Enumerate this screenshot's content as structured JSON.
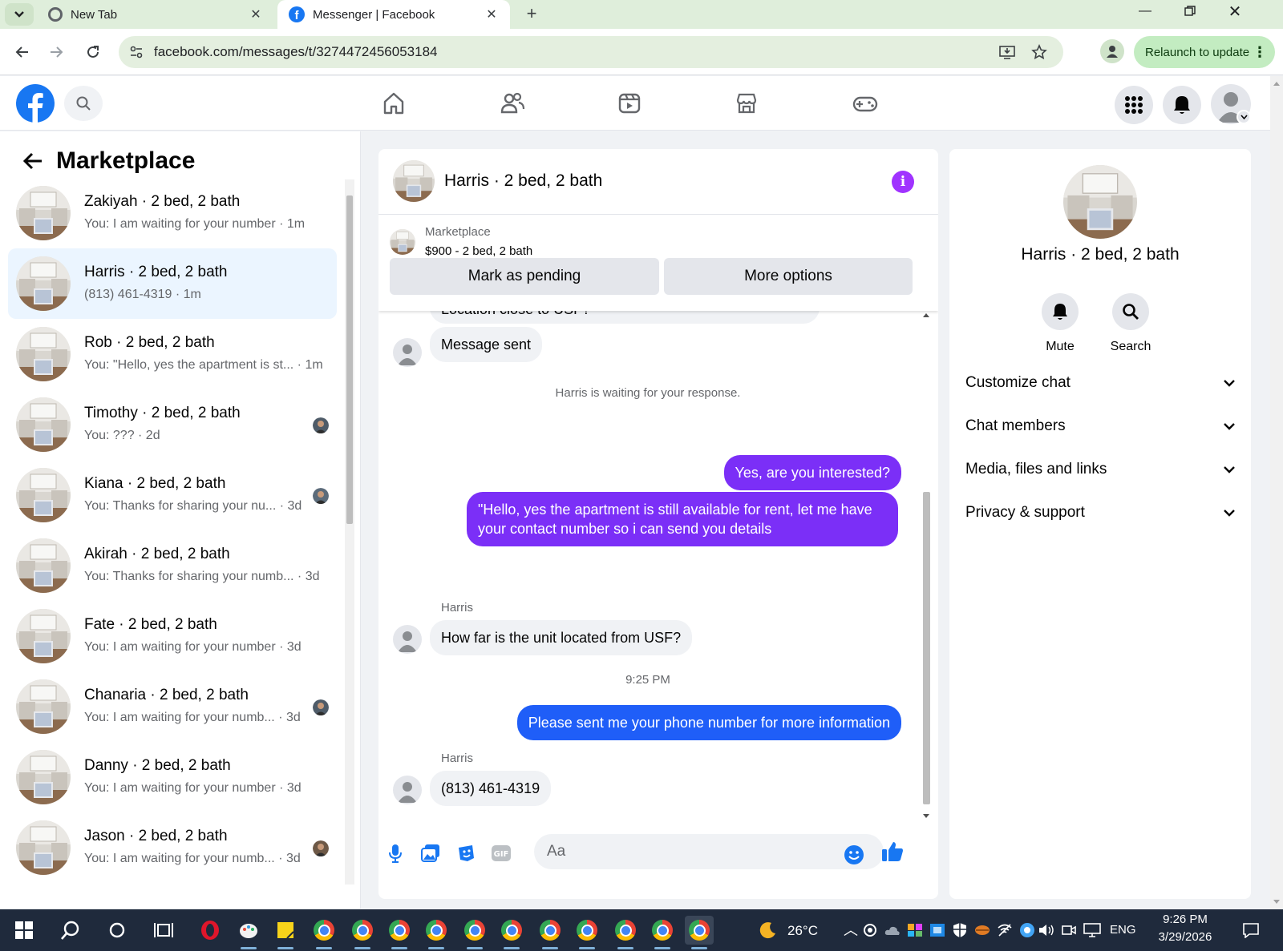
{
  "browser": {
    "tabs": [
      {
        "title": "New Tab"
      },
      {
        "title": "Messenger | Facebook"
      }
    ],
    "url": "facebook.com/messages/t/3274472456053184",
    "relaunch_label": "Relaunch to update"
  },
  "left": {
    "title": "Marketplace",
    "conversations": [
      {
        "name": "Zakiyah · 2 bed, 2 bath",
        "preview": "You: I am waiting for your number · 1m",
        "seen": false,
        "selected": false
      },
      {
        "name": "Harris · 2 bed, 2 bath",
        "preview": "(813) 461-4319 · 1m",
        "seen": false,
        "selected": true
      },
      {
        "name": "Rob · 2 bed, 2 bath",
        "preview": "You: \"Hello, yes the apartment is st... · 1m",
        "seen": false,
        "selected": false
      },
      {
        "name": "Timothy · 2 bed, 2 bath",
        "preview": "You: ??? · 2d",
        "seen": true,
        "selected": false
      },
      {
        "name": "Kiana · 2 bed, 2 bath",
        "preview": "You: Thanks for sharing your nu... · 3d",
        "seen": true,
        "selected": false
      },
      {
        "name": "Akirah · 2 bed, 2 bath",
        "preview": "You: Thanks for sharing your numb... · 3d",
        "seen": false,
        "selected": false
      },
      {
        "name": "Fate · 2 bed, 2 bath",
        "preview": "You: I am waiting for your number · 3d",
        "seen": false,
        "selected": false
      },
      {
        "name": "Chanaria · 2 bed, 2 bath",
        "preview": "You: I am waiting for your numb... · 3d",
        "seen": true,
        "selected": false
      },
      {
        "name": "Danny · 2 bed, 2 bath",
        "preview": "You: I am waiting for your number · 3d",
        "seen": false,
        "selected": false
      },
      {
        "name": "Jason · 2 bed, 2 bath",
        "preview": "You: I am waiting for your numb... · 3d",
        "seen": true,
        "selected": false
      }
    ]
  },
  "chat": {
    "title": "Harris · 2 bed, 2 bath",
    "listing_type": "Marketplace",
    "listing_desc": "$900 - 2 bed, 2 bath",
    "mark_pending_label": "Mark as pending",
    "more_options_label": "More options",
    "partial_message": "Location close to USF?",
    "message_sent": "Message sent",
    "waiting_note": "Harris is waiting for your response.",
    "out_msg_1": "Yes, are you interested?",
    "out_msg_2": "\"Hello, yes the apartment is still available for rent, let me have your contact number so i can send you details",
    "sender_1": "Harris",
    "in_msg_1": "How far is the unit located from USF?",
    "timestamp": "9:25 PM",
    "out_msg_3": "Please sent me your phone number for more information",
    "sender_2": "Harris",
    "in_msg_2": "(813) 461-4319",
    "composer_placeholder": "Aa"
  },
  "right": {
    "name": "Harris · 2 bed, 2 bath",
    "mute_label": "Mute",
    "search_label": "Search",
    "sections": [
      "Customize chat",
      "Chat members",
      "Media, files and links",
      "Privacy & support"
    ]
  },
  "taskbar": {
    "weather": "26°C",
    "language": "ENG",
    "time": "9:26 PM",
    "date": "3/29/2026"
  },
  "colors": {
    "fb_blue": "#1877f2",
    "purple_bubble": "#7b2ff7",
    "blue_bubble": "#1f5ef8",
    "selected_row": "#ebf5ff"
  }
}
